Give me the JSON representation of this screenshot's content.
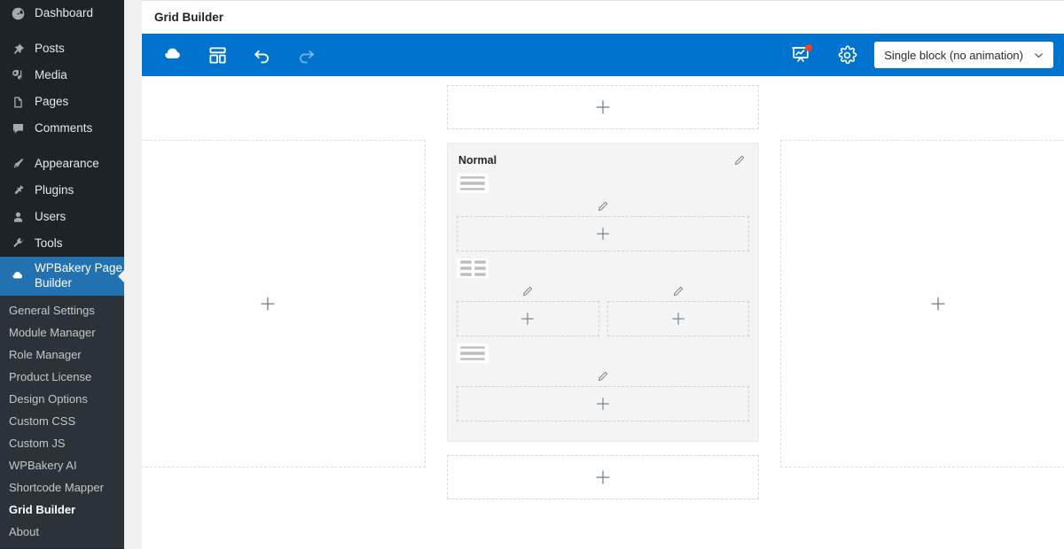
{
  "sidebar": {
    "items": [
      {
        "label": "Dashboard",
        "icon": "dashboard-icon",
        "active": false
      },
      {
        "label": "Posts",
        "icon": "pin-icon",
        "active": false
      },
      {
        "label": "Media",
        "icon": "media-icon",
        "active": false
      },
      {
        "label": "Pages",
        "icon": "pages-icon",
        "active": false
      },
      {
        "label": "Comments",
        "icon": "comments-icon",
        "active": false
      },
      {
        "label": "Appearance",
        "icon": "brush-icon",
        "active": false
      },
      {
        "label": "Plugins",
        "icon": "plug-icon",
        "active": false
      },
      {
        "label": "Users",
        "icon": "user-icon",
        "active": false
      },
      {
        "label": "Tools",
        "icon": "wrench-icon",
        "active": false
      },
      {
        "label": "WPBakery Page Builder",
        "icon": "wpbakery-logo-icon",
        "active": true
      }
    ],
    "submenu": [
      {
        "label": "General Settings",
        "current": false
      },
      {
        "label": "Module Manager",
        "current": false
      },
      {
        "label": "Role Manager",
        "current": false
      },
      {
        "label": "Product License",
        "current": false
      },
      {
        "label": "Design Options",
        "current": false
      },
      {
        "label": "Custom CSS",
        "current": false
      },
      {
        "label": "Custom JS",
        "current": false
      },
      {
        "label": "WPBakery AI",
        "current": false
      },
      {
        "label": "Shortcode Mapper",
        "current": false
      },
      {
        "label": "Grid Builder",
        "current": true
      },
      {
        "label": "About",
        "current": false
      }
    ]
  },
  "header": {
    "title": "Grid Builder"
  },
  "toolbar": {
    "accent_color": "#0073cf",
    "badge_color": "#e8452c",
    "logo_label": "WPBakery",
    "templates_label": "Templates",
    "undo_label": "Undo",
    "redo_label": "Redo",
    "preview_label": "Preview",
    "settings_label": "Settings",
    "animation_select": {
      "value": "Single block (no animation)",
      "options": [
        "Single block (no animation)"
      ]
    }
  },
  "canvas": {
    "left_panel": {
      "plus_label": "+"
    },
    "right_panel": {
      "plus_label": "+"
    },
    "top_drop_zone": {
      "plus_label": "+"
    },
    "bottom_drop_zone": {
      "plus_label": "+"
    },
    "section": {
      "label": "Normal",
      "edit_label": "Edit section",
      "rows": [
        {
          "handle": "single-column",
          "columns": [
            {
              "plus_label": "+",
              "edit_label": "Edit column"
            }
          ]
        },
        {
          "handle": "two-column",
          "columns": [
            {
              "plus_label": "+",
              "edit_label": "Edit column"
            },
            {
              "plus_label": "+",
              "edit_label": "Edit column"
            }
          ]
        },
        {
          "handle": "single-column",
          "columns": [
            {
              "plus_label": "+",
              "edit_label": "Edit column"
            }
          ]
        }
      ]
    }
  }
}
